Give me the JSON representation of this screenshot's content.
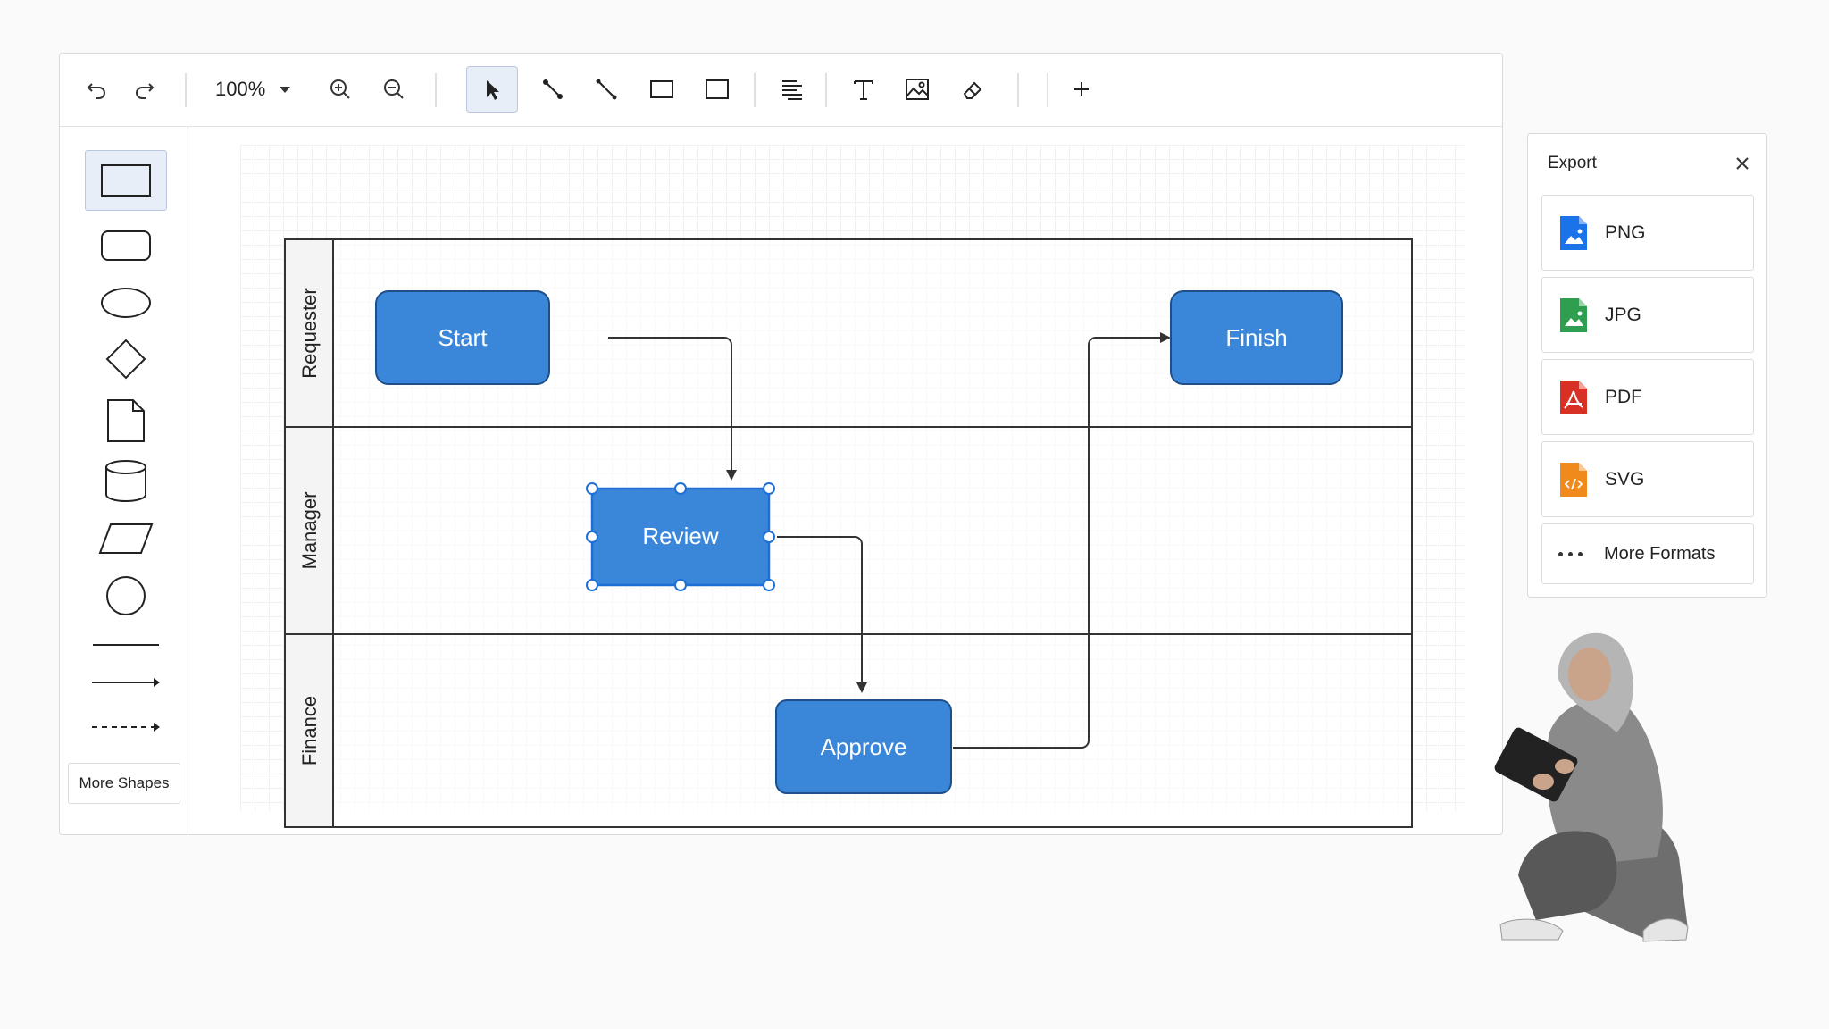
{
  "toolbar": {
    "zoom_value": "100%"
  },
  "palette": {
    "more_shapes_label": "More Shapes"
  },
  "diagram": {
    "lanes": [
      "Requester",
      "Manager",
      "Finance"
    ],
    "nodes": {
      "start": "Start",
      "review": "Review",
      "approve": "Approve",
      "finish": "Finish"
    },
    "colors": {
      "node_fill": "#3a86d8",
      "node_stroke": "#1f4f8a",
      "selection": "#1d6fd6"
    }
  },
  "export": {
    "title": "Export",
    "formats": [
      {
        "label": "PNG",
        "color": "#1a73e8"
      },
      {
        "label": "JPG",
        "color": "#2e9e4f"
      },
      {
        "label": "PDF",
        "color": "#d93025"
      },
      {
        "label": "SVG",
        "color": "#f08a1c"
      }
    ],
    "more_label": "More Formats"
  }
}
